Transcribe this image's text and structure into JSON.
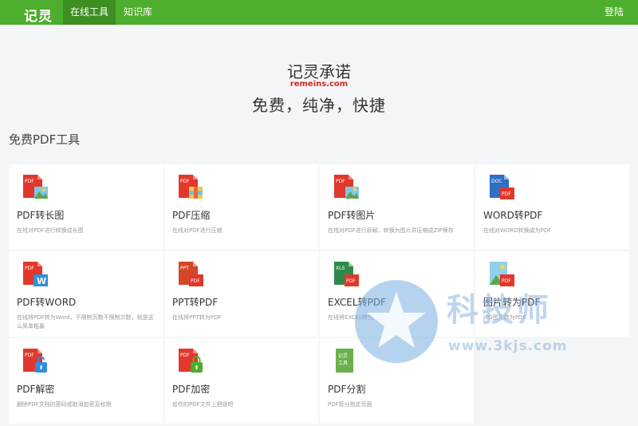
{
  "nav": {
    "logo": "记灵",
    "tabs": [
      {
        "label": "在线工具",
        "active": true
      },
      {
        "label": "知识库",
        "active": false
      }
    ],
    "login": "登陆"
  },
  "hero": {
    "title": "记灵承诺",
    "domain": "remeins.com",
    "slogan": "免费，纯净，快捷"
  },
  "section_title": "免费PDF工具",
  "tools": [
    {
      "name": "PDF转长图",
      "desc": "在线对PDF进行转换成长图",
      "icon": "pdf-to-image-icon",
      "badge": "PDF"
    },
    {
      "name": "PDF压缩",
      "desc": "在线对PDF进行压缩",
      "icon": "pdf-compress-icon",
      "badge": "PDF"
    },
    {
      "name": "PDF转图片",
      "desc": "在线对PDF进行拆解，转换为图片并压缩成ZIP保存",
      "icon": "pdf-to-picture-icon",
      "badge": "PDF"
    },
    {
      "name": "WORD转PDF",
      "desc": "在线对WORD转换成为PDF",
      "icon": "word-to-pdf-icon",
      "badge": "DOC"
    },
    {
      "name": "PDF转WORD",
      "desc": "在线将PDF转为Word，不限制页数不限制次数，就是这么简单粗暴",
      "icon": "pdf-to-word-icon",
      "badge": "PDF"
    },
    {
      "name": "PPT转PDF",
      "desc": "在线将PPT转为PDF",
      "icon": "ppt-to-pdf-icon",
      "badge": "PPT"
    },
    {
      "name": "EXCEL转PDF",
      "desc": "在线将EXCEL转为PDF",
      "icon": "excel-to-pdf-icon",
      "badge": "XLS"
    },
    {
      "name": "图片转为PDF",
      "desc": "JPG图片转为PDF",
      "icon": "image-to-pdf-icon",
      "badge": ""
    },
    {
      "name": "PDF解密",
      "desc": "删除PDF文档的密码或取消加密及权限",
      "icon": "pdf-decrypt-icon",
      "badge": "PDF"
    },
    {
      "name": "PDF加密",
      "desc": "给你的PDF文件上把锁吧",
      "icon": "pdf-encrypt-icon",
      "badge": "PDF"
    },
    {
      "name": "PDF分割",
      "desc": "PDF拆分指定页面",
      "icon": "pdf-split-icon",
      "badge": "记灵工具"
    }
  ],
  "watermark": {
    "text": "科技师",
    "url": "www.3kjs.com"
  },
  "colors": {
    "brand_green": "#4cae2c",
    "pdf_red": "#e2372b",
    "word_blue": "#2f6fc4",
    "excel_green": "#2e8a4a",
    "ppt_red": "#d24726"
  }
}
